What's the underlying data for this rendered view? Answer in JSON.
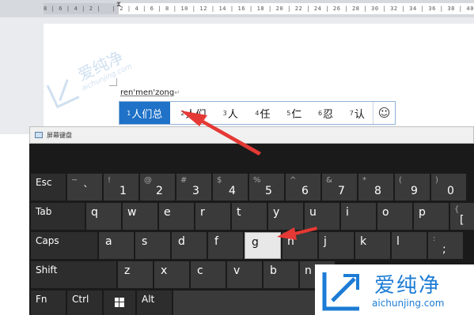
{
  "ruler": {
    "ticks": "8 | 6 | 4 | 2 |   | 2 | 4 | 6 | 8 | 10 | 12 | 14 | 16 | 18 | 20 | 22 | 24 | 26 | 28 | 30 | 32 | 34 | 36 | 38 | 40 | 42 | 44 | 46"
  },
  "document": {
    "composition": "ren'men'zong",
    "paragraph_mark": "↵"
  },
  "ime": {
    "candidates": [
      {
        "num": "1",
        "text": "人们总"
      },
      {
        "num": "2",
        "text": "人们"
      },
      {
        "num": "3",
        "text": "人"
      },
      {
        "num": "4",
        "text": "任"
      },
      {
        "num": "5",
        "text": "仁"
      },
      {
        "num": "6",
        "text": "忍"
      },
      {
        "num": "7",
        "text": "认"
      }
    ],
    "emoji_glyph": "☺"
  },
  "keyboard": {
    "title": "屏幕键盘",
    "row1": [
      {
        "label": "Esc"
      },
      {
        "shift": "~",
        "main": "`"
      },
      {
        "shift": "!",
        "main": "1"
      },
      {
        "shift": "@",
        "main": "2"
      },
      {
        "shift": "#",
        "main": "3"
      },
      {
        "shift": "$",
        "main": "4"
      },
      {
        "shift": "%",
        "main": "5"
      },
      {
        "shift": "^",
        "main": "6"
      },
      {
        "shift": "&",
        "main": "7"
      },
      {
        "shift": "*",
        "main": "8"
      },
      {
        "shift": "(",
        "main": "9"
      },
      {
        "shift": ")",
        "main": "0"
      }
    ],
    "row2": [
      {
        "label": "Tab"
      },
      {
        "main": "q"
      },
      {
        "main": "w"
      },
      {
        "main": "e"
      },
      {
        "main": "r"
      },
      {
        "main": "t"
      },
      {
        "main": "y"
      },
      {
        "main": "u"
      },
      {
        "main": "i"
      },
      {
        "main": "o"
      },
      {
        "main": "p"
      },
      {
        "shift": "{",
        "main": "["
      }
    ],
    "row3": [
      {
        "label": "Caps"
      },
      {
        "main": "a"
      },
      {
        "main": "s"
      },
      {
        "main": "d"
      },
      {
        "main": "f"
      },
      {
        "main": "g"
      },
      {
        "main": "h"
      },
      {
        "main": "j"
      },
      {
        "main": "k"
      },
      {
        "main": "l"
      },
      {
        "shift": ":",
        "main": ";"
      }
    ],
    "row4": [
      {
        "label": "Shift"
      },
      {
        "main": "z"
      },
      {
        "main": "x"
      },
      {
        "main": "c"
      },
      {
        "main": "v"
      },
      {
        "main": "b"
      },
      {
        "main": "n"
      }
    ],
    "row5": [
      {
        "label": "Fn"
      },
      {
        "label": "Ctrl"
      },
      {
        "label": "win-icon"
      },
      {
        "label": "Alt"
      },
      {
        "label": ""
      }
    ]
  },
  "watermark": {
    "title": "爱纯净",
    "url": "aichunjing.com",
    "top_url": "aichunjing.com"
  },
  "colors": {
    "ime_selected": "#1f72c8",
    "arrow": "#e53935",
    "key": "#3a3a3a",
    "key_highlight": "#e8e8e8",
    "watermark": "#1c7cd5"
  }
}
